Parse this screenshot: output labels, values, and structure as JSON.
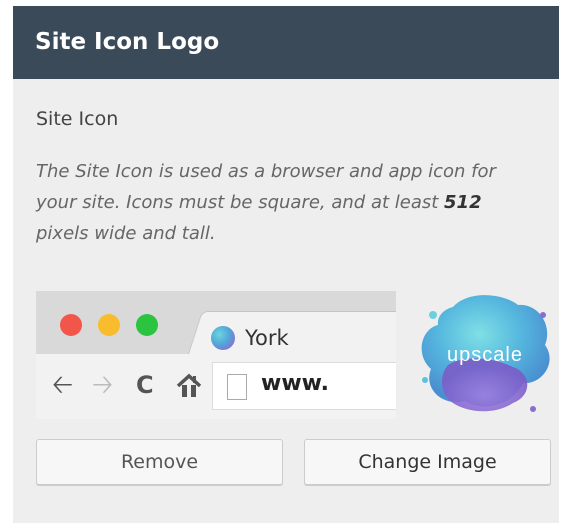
{
  "header": {
    "title": "Site Icon Logo"
  },
  "section": {
    "label": "Site Icon",
    "description_before": "The Site Icon is used as a browser and app icon for your site. Icons must be square, and at least ",
    "description_size": "512",
    "description_after": " pixels wide and tall."
  },
  "preview": {
    "tab_title": "York",
    "url": "www.",
    "colors": {
      "red": "#f2564a",
      "yellow": "#f9bc2d",
      "green": "#2bc440"
    },
    "icons": [
      "back-arrow-icon",
      "forward-arrow-icon",
      "reload-icon",
      "home-icon",
      "page-icon"
    ]
  },
  "logo": {
    "text": "upscale"
  },
  "buttons": {
    "remove": "Remove",
    "change": "Change Image"
  },
  "colors": {
    "header_bg": "#3a4a59",
    "panel_bg": "#eeeeee"
  }
}
